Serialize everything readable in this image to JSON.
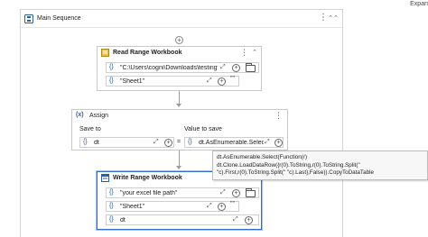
{
  "topbar": {
    "expand_label": "Expan"
  },
  "sequence": {
    "title": "Main Sequence",
    "kebab_icon": "kebab-icon",
    "collapse_glyph": "⌃"
  },
  "read_range": {
    "title": "Read Range Workbook",
    "path_value": "\"C:\\Users\\cogni\\Downloads\\testingfor",
    "sheet_value": "\"Sheet1\"",
    "quote_glyph": "\"\""
  },
  "assign": {
    "title": "Assign",
    "label_left": "Save to",
    "label_right": "Value to save",
    "to_value": "dt",
    "equals": "=",
    "value_value": "dt.AsEnumerable.Selec"
  },
  "tooltip": {
    "text": "dt.AsEnumerable.Select(Function(r) dt.Clone.LoadDataRow({r(0).ToString,r(0).ToString.Split(\" \"c).First,r(0).ToString.Split(\" \"c).Last},False)).CopyToDataTable"
  },
  "write_range": {
    "title": "Write Range Workbook",
    "path_value": "\"your excel file path\"",
    "sheet_value": "\"Sheet1\"",
    "data_value": "dt",
    "quote_glyph": "\"\""
  },
  "field_brace": "{}",
  "plus_glyph": "+",
  "colors": {
    "accent": "#2f6fd1",
    "border": "#c8c8c8",
    "tooltip_bg": "#f7f7f7"
  }
}
